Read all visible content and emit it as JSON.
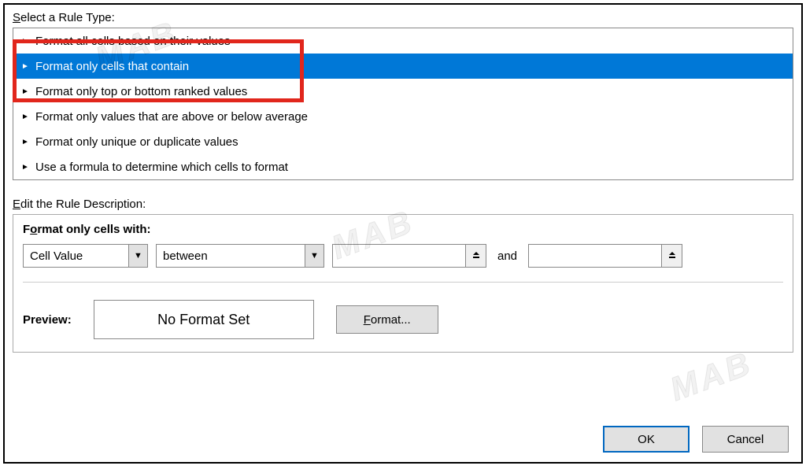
{
  "labels": {
    "select_rule_type_pre": "S",
    "select_rule_type_rest": "elect a Rule Type:",
    "edit_rule_desc_pre": "E",
    "edit_rule_desc_rest": "dit the Rule Description:",
    "format_only_with_pre": "F",
    "format_only_with_rest_bold_o": "o",
    "format_only_with_rest": "rmat only cells with:",
    "and": "and",
    "preview": "Preview:",
    "no_format_set": "No Format Set",
    "format_btn_pre": "F",
    "format_btn_rest": "ormat...",
    "ok": "OK",
    "cancel": "Cancel"
  },
  "rule_types": [
    "Format all cells based on their values",
    "Format only cells that contain",
    "Format only top or bottom ranked values",
    "Format only values that are above or below average",
    "Format only unique or duplicate values",
    "Use a formula to determine which cells to format"
  ],
  "selected_rule_index": 1,
  "combo1": {
    "value": "Cell Value"
  },
  "combo2": {
    "value": "between"
  },
  "ref1": {
    "value": ""
  },
  "ref2": {
    "value": ""
  },
  "watermark": "MAB"
}
